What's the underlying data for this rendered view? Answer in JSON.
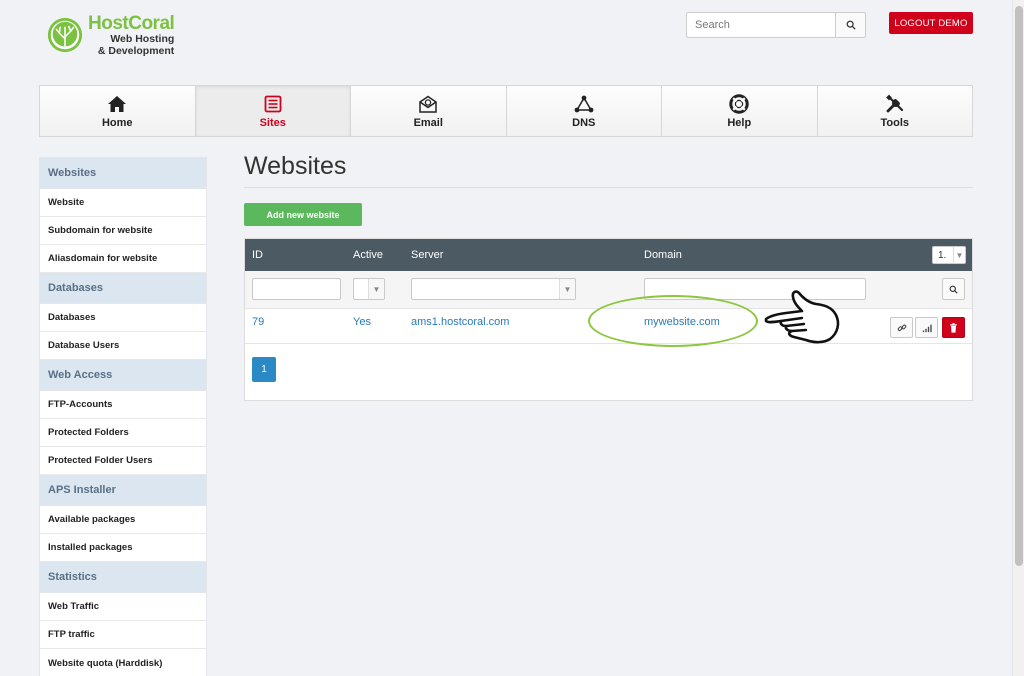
{
  "brand": {
    "name": "HostCoral",
    "tagline_1": "Web Hosting",
    "tagline_2": "& Development",
    "color": "#7cc242"
  },
  "search": {
    "placeholder": "Search",
    "icon": "search-icon"
  },
  "logout_label": "LOGOUT DEMO",
  "nav": [
    {
      "label": "Home",
      "icon": "home-icon"
    },
    {
      "label": "Sites",
      "icon": "sites-icon",
      "active": true
    },
    {
      "label": "Email",
      "icon": "email-icon"
    },
    {
      "label": "DNS",
      "icon": "dns-icon"
    },
    {
      "label": "Help",
      "icon": "lifebuoy-icon"
    },
    {
      "label": "Tools",
      "icon": "tools-icon"
    }
  ],
  "sidebar": {
    "groups": [
      {
        "title": "Websites",
        "items": [
          "Website",
          "Subdomain for website",
          "Aliasdomain for website"
        ]
      },
      {
        "title": "Databases",
        "items": [
          "Databases",
          "Database Users"
        ]
      },
      {
        "title": "Web Access",
        "items": [
          "FTP-Accounts",
          "Protected Folders",
          "Protected Folder Users"
        ]
      },
      {
        "title": "APS Installer",
        "items": [
          "Available packages",
          "Installed packages"
        ]
      },
      {
        "title": "Statistics",
        "items": [
          "Web Traffic",
          "FTP traffic",
          "Website quota (Harddisk)"
        ]
      }
    ]
  },
  "main": {
    "title": "Websites",
    "add_button": "Add new website",
    "table": {
      "columns": [
        "ID",
        "Active",
        "Server",
        "Domain"
      ],
      "per_page": "1.",
      "rows": [
        {
          "id": "79",
          "active": "Yes",
          "server": "ams1.hostcoral.com",
          "domain": "mywebsite.com"
        }
      ]
    },
    "pagination": {
      "current": "1"
    }
  },
  "colors": {
    "danger": "#d0021b",
    "success": "#5cb85c",
    "link": "#2a7ab8",
    "table_header": "#4b5a63",
    "sidebar_head": "#dbe6f1",
    "highlight": "#8dc63f"
  }
}
